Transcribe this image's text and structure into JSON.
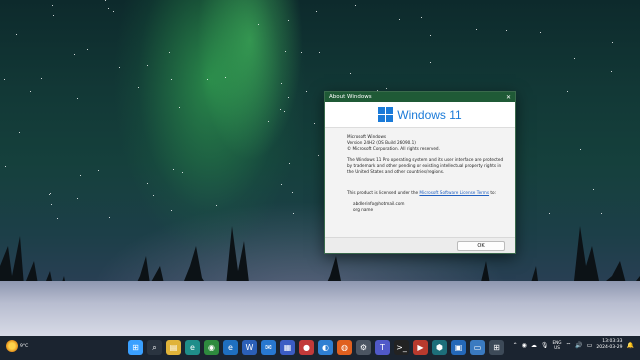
{
  "dialog": {
    "title": "About Windows",
    "brand": "Windows 11",
    "product": "Microsoft Windows",
    "version": "Version 24H2 (OS Build 26090.1)",
    "copyright": "© Microsoft Corporation. All rights reserved.",
    "legal": "The Windows 11 Pro operating system and its user interface are protected by trademark and other pending or existing intellectual property rights in the United States and other countries/regions.",
    "license_prefix": "This product is licensed under the",
    "license_link": "Microsoft Software License Terms",
    "license_suffix": "to:",
    "user": "abdlerinfo@hotmail.com",
    "org": "org name",
    "ok_label": "OK"
  },
  "taskbar": {
    "weather_temp": "9°C",
    "apps": [
      {
        "name": "start",
        "glyph": "⊞",
        "color": "#3aa0ff"
      },
      {
        "name": "search",
        "glyph": "⌕",
        "color": "#2a3440"
      },
      {
        "name": "file-explorer",
        "glyph": "▤",
        "color": "#e0b33a"
      },
      {
        "name": "edge",
        "glyph": "e",
        "color": "#1f8e8a"
      },
      {
        "name": "chrome",
        "glyph": "◉",
        "color": "#2e8b3e"
      },
      {
        "name": "edge-beta",
        "glyph": "e",
        "color": "#1f6fbf"
      },
      {
        "name": "word",
        "glyph": "W",
        "color": "#2b5fb8"
      },
      {
        "name": "mail",
        "glyph": "✉",
        "color": "#2878d0"
      },
      {
        "name": "calendar",
        "glyph": "▦",
        "color": "#3b5cc4"
      },
      {
        "name": "app-red",
        "glyph": "●",
        "color": "#c23a3a"
      },
      {
        "name": "photos",
        "glyph": "◐",
        "color": "#2f7fd2"
      },
      {
        "name": "firefox",
        "glyph": "◍",
        "color": "#e0601f"
      },
      {
        "name": "settings",
        "glyph": "⚙",
        "color": "#4b5562"
      },
      {
        "name": "teams",
        "glyph": "T",
        "color": "#5059c9"
      },
      {
        "name": "terminal",
        "glyph": ">_",
        "color": "#222"
      },
      {
        "name": "media-player",
        "glyph": "▶",
        "color": "#b83a2e"
      },
      {
        "name": "vpn",
        "glyph": "⬢",
        "color": "#1d6e7a"
      },
      {
        "name": "store",
        "glyph": "▣",
        "color": "#2468b8"
      },
      {
        "name": "monitor",
        "glyph": "▭",
        "color": "#3a7ac0"
      },
      {
        "name": "about-windows",
        "glyph": "⊞",
        "color": "#3d4a58"
      }
    ],
    "lang_top": "ENG",
    "lang_bottom": "US",
    "time": "13:03:33",
    "date": "2024-03-29"
  }
}
